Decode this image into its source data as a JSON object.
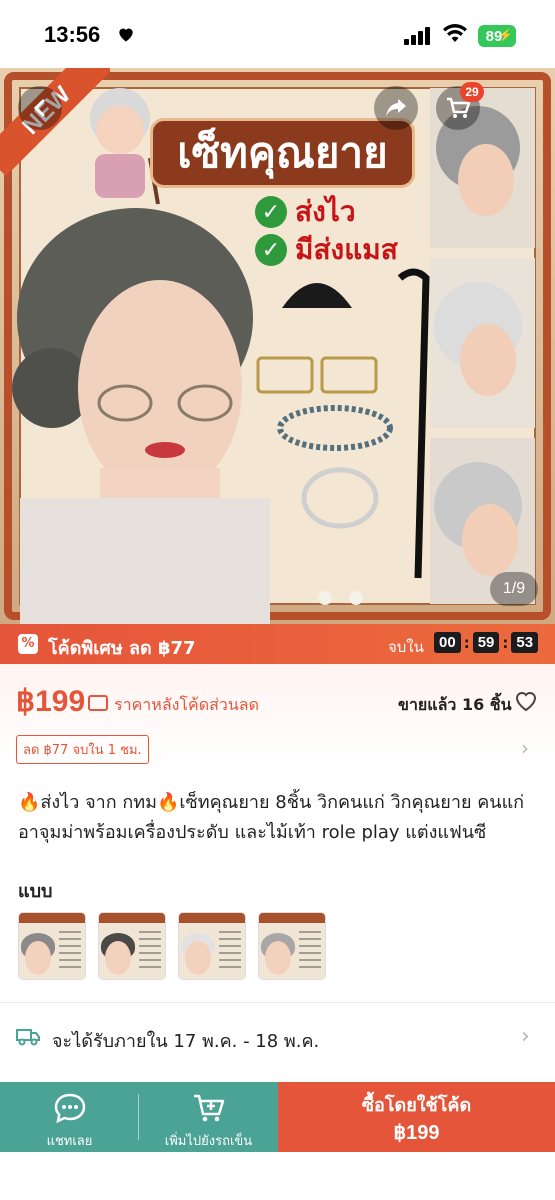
{
  "status_bar": {
    "time": "13:56",
    "battery": "89"
  },
  "hero": {
    "new_badge": "NEW",
    "title": "เซ็ทคุณยาย",
    "checks": [
      "ส่งไว",
      "มีส่งแมส"
    ],
    "cart_count": "29",
    "image_counter": "1/9"
  },
  "promo": {
    "label": "โค้ดพิเศษ ลด ฿77",
    "ends_in": "จบใน",
    "timer": [
      "00",
      "59",
      "53"
    ],
    "colors": {
      "accent": "#e5553a"
    }
  },
  "price": {
    "amount": "฿199",
    "note": "ราคาหลังโค้ดส่วนลด",
    "sold": "ขายแล้ว 16 ชิ้น",
    "discount_chip": "ลด ฿77 จบใน 1 ชม."
  },
  "description": "🔥ส่งไว จาก กทม🔥เซ็ทคุณยาย 8ชิ้น  วิกคนแก่ วิกคุณยาย คนแก่ อาจุมม่าพร้อมเครื่องประดับ และไม้เท้า role play แต่งแฟนซี",
  "variants": {
    "label": "แบบ",
    "items": [
      {
        "hair_color": "#8a8a8a"
      },
      {
        "hair_color": "#4a4a48"
      },
      {
        "hair_color": "#e2e2e2"
      },
      {
        "hair_color": "#a7a7a7"
      }
    ]
  },
  "delivery": {
    "text": "จะได้รับภายใน 17 พ.ค. - 18 พ.ค."
  },
  "bottom_bar": {
    "chat_label": "แชทเลย",
    "cart_label": "เพิ่มไปยังรถเข็น",
    "buy_title": "ซื้อโดยใช้โค้ด",
    "buy_price": "฿199",
    "colors": {
      "teal": "#4aa394",
      "buy": "#e5553a"
    }
  }
}
